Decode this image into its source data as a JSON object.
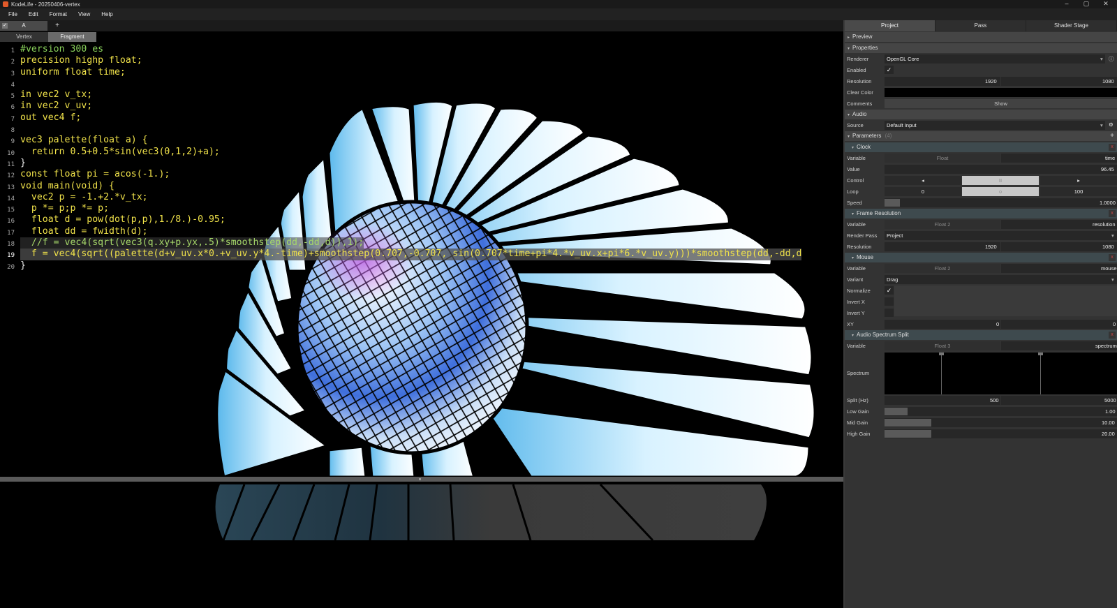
{
  "window": {
    "title": "KodeLife - 20250406-vertex",
    "controls": [
      "–",
      "▢",
      "✕"
    ]
  },
  "menu": [
    "File",
    "Edit",
    "Format",
    "View",
    "Help"
  ],
  "document_tabs": {
    "active": "A",
    "add": "+"
  },
  "stage_tabs": {
    "vertex": "Vertex",
    "fragment": "Fragment",
    "active": "Fragment"
  },
  "code": {
    "line_numbers": [
      "1",
      "2",
      "3",
      "4",
      "5",
      "6",
      "7",
      "8",
      "9",
      "10",
      "11",
      "12",
      "13",
      "14",
      "15",
      "16",
      "17",
      "18",
      "19",
      "20"
    ],
    "current_line": 19,
    "lines": [
      "#version 300 es",
      "precision highp float;",
      "uniform float time;",
      "",
      "in vec2 v_tx;",
      "in vec2 v_uv;",
      "out vec4 f;",
      "",
      "vec3 palette(float a) {",
      "  return 0.5+0.5*sin(vec3(0,1,2)+a);",
      "}",
      "const float pi = acos(-1.);",
      "void main(void) {",
      "  vec2 p = -1.+2.*v_tx;",
      "  p *= p;p *= p;",
      "  float d = pow(dot(p,p),1./8.)-0.95;",
      "  float dd = fwidth(d);",
      "  //f = vec4(sqrt(vec3(q.xy+p.yx,.5)*smoothstep(dd,-dd,d)),1);",
      "  f = vec4(sqrt((palette(d+v_uv.x*0.+v_uv.y*4.-time)+smoothstep(0.707,-0.707, sin(0.707*time+pi*4.*v_uv.x+pi*6.*v_uv.y)))*smoothstep(dd,-dd,d",
      "}"
    ]
  },
  "side_tabs": [
    "Project",
    "Pass",
    "Shader Stage"
  ],
  "sections": {
    "preview": "Preview",
    "properties": "Properties",
    "audio": "Audio",
    "parameters": "Parameters",
    "parameters_count": "(4)"
  },
  "properties": {
    "renderer_label": "Renderer",
    "renderer_value": "OpenGL Core",
    "enabled_label": "Enabled",
    "resolution_label": "Resolution",
    "res_w": "1920",
    "res_h": "1080",
    "clear_color_label": "Clear Color",
    "comments_label": "Comments",
    "comments_button": "Show"
  },
  "audio": {
    "source_label": "Source",
    "source_value": "Default Input"
  },
  "clock": {
    "title": "Clock",
    "variable_label": "Variable",
    "type": "Float",
    "name": "time",
    "value_label": "Value",
    "value": "96.45",
    "control_label": "Control",
    "prev": "◂",
    "pause": "II",
    "next": "▸",
    "loop_label": "Loop",
    "loop_min": "0",
    "loop_mark": "○",
    "loop_max": "100",
    "speed_label": "Speed",
    "speed": "1.0000"
  },
  "frame_resolution": {
    "title": "Frame Resolution",
    "variable_label": "Variable",
    "type": "Float 2",
    "name": "resolution",
    "render_pass_label": "Render Pass",
    "render_pass": "Project",
    "resolution_label": "Resolution",
    "w": "1920",
    "h": "1080"
  },
  "mouse": {
    "title": "Mouse",
    "variable_label": "Variable",
    "type": "Float 2",
    "name": "mouse",
    "variant_label": "Variant",
    "variant": "Drag",
    "normalize_label": "Normalize",
    "invert_x_label": "Invert X",
    "invert_y_label": "Invert Y",
    "xy_label": "XY",
    "x": "0",
    "y": "0"
  },
  "audio_spectrum": {
    "title": "Audio Spectrum Split",
    "variable_label": "Variable",
    "type": "Float 3",
    "name": "spectrum",
    "spectrum_label": "Spectrum",
    "split_label": "Split (Hz)",
    "split_low": "500",
    "split_high": "5000",
    "low_gain_label": "Low Gain",
    "low_gain": "1.00",
    "low_gain_level": 0.1,
    "mid_gain_label": "Mid Gain",
    "mid_gain": "10.00",
    "mid_gain_level": 0.2,
    "high_gain_label": "High Gain",
    "high_gain": "20.00",
    "high_gain_level": 0.2
  },
  "colors": {
    "accent_teal": "#3e4a4e",
    "close_red": "#d04848",
    "panel": "#333333",
    "editor_bg": "#000000"
  }
}
